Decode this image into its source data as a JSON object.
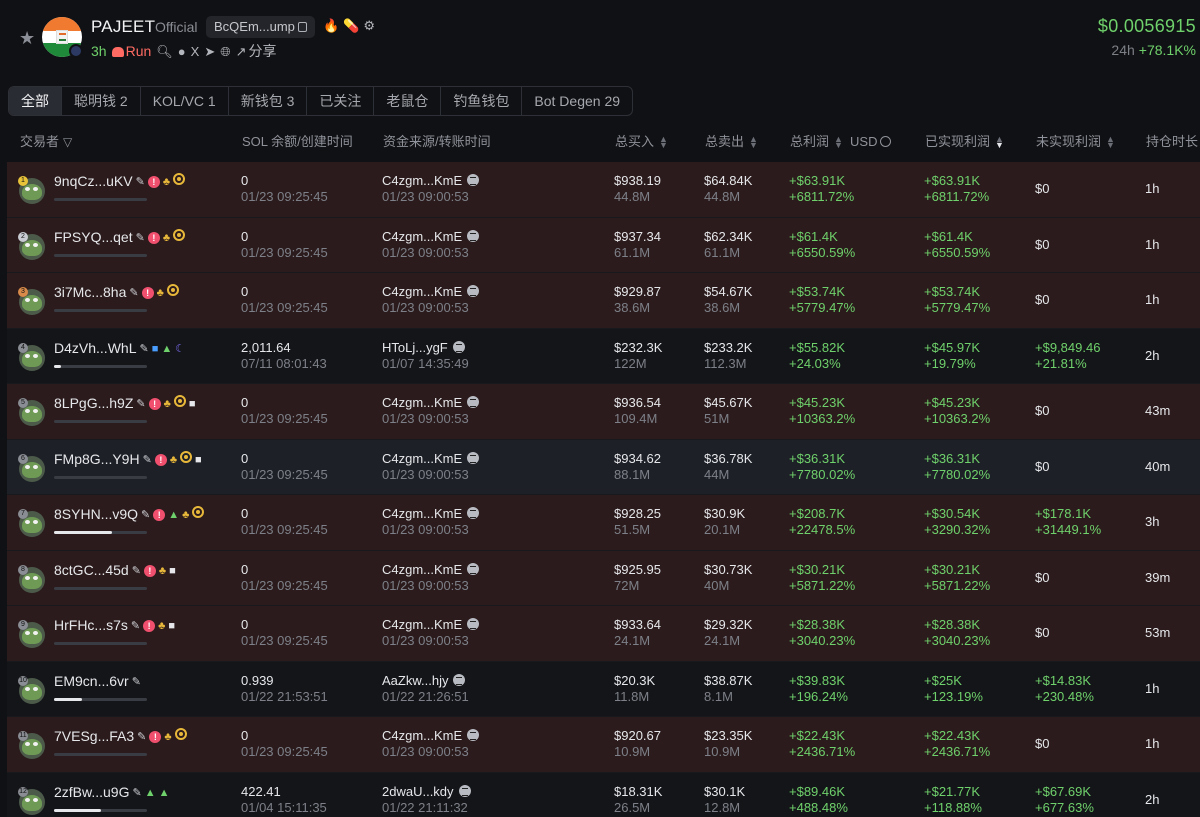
{
  "header": {
    "token_name": "PAJEET",
    "tag": "Official",
    "address": "BcQEm...ump",
    "age": "3h",
    "run": "Run",
    "share": "分享",
    "price": "$0.0056915",
    "change_label": "24h",
    "change_value": "+78.1K%",
    "accent": "#6fd16b"
  },
  "tabs": [
    {
      "label": "全部"
    },
    {
      "label": "聪明钱 2"
    },
    {
      "label": "KOL/VC 1"
    },
    {
      "label": "新钱包 3"
    },
    {
      "label": "已关注"
    },
    {
      "label": "老鼠仓"
    },
    {
      "label": "钓鱼钱包"
    },
    {
      "label": "Bot Degen 29"
    }
  ],
  "columns": {
    "trader": "交易者",
    "sol": "SOL 余额/创建时间",
    "source": "资金来源/转账时间",
    "buy": "总买入",
    "sell": "总卖出",
    "pnl": "总利润",
    "pnl_unit": "USD",
    "realized": "已实现利润",
    "unrealized": "未实现利润",
    "hold": "持仓时长"
  },
  "rows": [
    {
      "rank": "1",
      "addr": "9nqCz...uKV",
      "icons": "pen,warn,grp,tgt",
      "bar": 0,
      "sol": "0",
      "created": "01/23 09:25:45",
      "src": "C4zgm...KmE",
      "src_time": "01/23 09:00:53",
      "buy": "$938.19",
      "buy_sub": "44.8M",
      "sell": "$64.84K",
      "sell_sub": "44.8M",
      "pnl": "+$63.91K",
      "pnl_pct": "+6811.72%",
      "real": "+$63.91K",
      "real_pct": "+6811.72%",
      "unreal": "$0",
      "unreal_pct": "",
      "hold": "1h",
      "style": "red"
    },
    {
      "rank": "2",
      "addr": "FPSYQ...qet",
      "icons": "pen,warn,grp,tgt",
      "bar": 0,
      "sol": "0",
      "created": "01/23 09:25:45",
      "src": "C4zgm...KmE",
      "src_time": "01/23 09:00:53",
      "buy": "$937.34",
      "buy_sub": "61.1M",
      "sell": "$62.34K",
      "sell_sub": "61.1M",
      "pnl": "+$61.4K",
      "pnl_pct": "+6550.59%",
      "real": "+$61.4K",
      "real_pct": "+6550.59%",
      "unreal": "$0",
      "unreal_pct": "",
      "hold": "1h",
      "style": "red"
    },
    {
      "rank": "3",
      "addr": "3i7Mc...8ha",
      "icons": "pen,warn,grp,tgt",
      "bar": 0,
      "sol": "0",
      "created": "01/23 09:25:45",
      "src": "C4zgm...KmE",
      "src_time": "01/23 09:00:53",
      "buy": "$929.87",
      "buy_sub": "38.6M",
      "sell": "$54.67K",
      "sell_sub": "38.6M",
      "pnl": "+$53.74K",
      "pnl_pct": "+5779.47%",
      "real": "+$53.74K",
      "real_pct": "+5779.47%",
      "unreal": "$0",
      "unreal_pct": "",
      "hold": "1h",
      "style": "red"
    },
    {
      "rank": "4",
      "addr": "D4zVh...WhL",
      "icons": "pen,blue,green,moon",
      "bar": 0.08,
      "sol": "2,011.64",
      "created": "07/11 08:01:43",
      "src": "HToLj...ygF",
      "src_time": "01/07 14:35:49",
      "buy": "$232.3K",
      "buy_sub": "122M",
      "sell": "$233.2K",
      "sell_sub": "112.3M",
      "pnl": "+$55.82K",
      "pnl_pct": "+24.03%",
      "real": "+$45.97K",
      "real_pct": "+19.79%",
      "unreal": "+$9,849.46",
      "unreal_pct": "+21.81%",
      "hold": "2h",
      "style": "dark"
    },
    {
      "rank": "5",
      "addr": "8LPgG...h9Z",
      "icons": "pen,warn,grp,tgt,doc",
      "bar": 0,
      "sol": "0",
      "created": "01/23 09:25:45",
      "src": "C4zgm...KmE",
      "src_time": "01/23 09:00:53",
      "buy": "$936.54",
      "buy_sub": "109.4M",
      "sell": "$45.67K",
      "sell_sub": "51M",
      "pnl": "+$45.23K",
      "pnl_pct": "+10363.2%",
      "real": "+$45.23K",
      "real_pct": "+10363.2%",
      "unreal": "$0",
      "unreal_pct": "",
      "hold": "43m",
      "style": "red"
    },
    {
      "rank": "6",
      "addr": "FMp8G...Y9H",
      "icons": "pen,warn,grp,tgt,doc",
      "bar": 0,
      "sol": "0",
      "created": "01/23 09:25:45",
      "src": "C4zgm...KmE",
      "src_time": "01/23 09:00:53",
      "buy": "$934.62",
      "buy_sub": "88.1M",
      "sell": "$36.78K",
      "sell_sub": "44M",
      "pnl": "+$36.31K",
      "pnl_pct": "+7780.02%",
      "real": "+$36.31K",
      "real_pct": "+7780.02%",
      "unreal": "$0",
      "unreal_pct": "",
      "hold": "40m",
      "style": "hi"
    },
    {
      "rank": "7",
      "addr": "8SYHN...v9Q",
      "icons": "pen,warn,green,grp,tgt",
      "bar": 0.62,
      "sol": "0",
      "created": "01/23 09:25:45",
      "src": "C4zgm...KmE",
      "src_time": "01/23 09:00:53",
      "buy": "$928.25",
      "buy_sub": "51.5M",
      "sell": "$30.9K",
      "sell_sub": "20.1M",
      "pnl": "+$208.7K",
      "pnl_pct": "+22478.5%",
      "real": "+$30.54K",
      "real_pct": "+3290.32%",
      "unreal": "+$178.1K",
      "unreal_pct": "+31449.1%",
      "hold": "3h",
      "style": "red"
    },
    {
      "rank": "8",
      "addr": "8ctGC...45d",
      "icons": "pen,warn,grp,doc",
      "bar": 0,
      "sol": "0",
      "created": "01/23 09:25:45",
      "src": "C4zgm...KmE",
      "src_time": "01/23 09:00:53",
      "buy": "$925.95",
      "buy_sub": "72M",
      "sell": "$30.73K",
      "sell_sub": "40M",
      "pnl": "+$30.21K",
      "pnl_pct": "+5871.22%",
      "real": "+$30.21K",
      "real_pct": "+5871.22%",
      "unreal": "$0",
      "unreal_pct": "",
      "hold": "39m",
      "style": "red"
    },
    {
      "rank": "9",
      "addr": "HrFHc...s7s",
      "icons": "pen,warn,grp,doc",
      "bar": 0,
      "sol": "0",
      "created": "01/23 09:25:45",
      "src": "C4zgm...KmE",
      "src_time": "01/23 09:00:53",
      "buy": "$933.64",
      "buy_sub": "24.1M",
      "sell": "$29.32K",
      "sell_sub": "24.1M",
      "pnl": "+$28.38K",
      "pnl_pct": "+3040.23%",
      "real": "+$28.38K",
      "real_pct": "+3040.23%",
      "unreal": "$0",
      "unreal_pct": "",
      "hold": "53m",
      "style": "red"
    },
    {
      "rank": "10",
      "addr": "EM9cn...6vr",
      "icons": "pen",
      "bar": 0.3,
      "sol": "0.939",
      "created": "01/22 21:53:51",
      "src": "AaZkw...hjy",
      "src_time": "01/22 21:26:51",
      "buy": "$20.3K",
      "buy_sub": "11.8M",
      "sell": "$38.87K",
      "sell_sub": "8.1M",
      "pnl": "+$39.83K",
      "pnl_pct": "+196.24%",
      "real": "+$25K",
      "real_pct": "+123.19%",
      "unreal": "+$14.83K",
      "unreal_pct": "+230.48%",
      "hold": "1h",
      "style": "dark"
    },
    {
      "rank": "11",
      "addr": "7VESg...FA3",
      "icons": "pen,warn,grp,tgt",
      "bar": 0,
      "sol": "0",
      "created": "01/23 09:25:45",
      "src": "C4zgm...KmE",
      "src_time": "01/23 09:00:53",
      "buy": "$920.67",
      "buy_sub": "10.9M",
      "sell": "$23.35K",
      "sell_sub": "10.9M",
      "pnl": "+$22.43K",
      "pnl_pct": "+2436.71%",
      "real": "+$22.43K",
      "real_pct": "+2436.71%",
      "unreal": "$0",
      "unreal_pct": "",
      "hold": "1h",
      "style": "red"
    },
    {
      "rank": "12",
      "addr": "2zfBw...u9G",
      "icons": "pen,green,green",
      "bar": 0.5,
      "sol": "422.41",
      "created": "01/04 15:11:35",
      "src": "2dwaU...kdy",
      "src_time": "01/22 21:11:32",
      "buy": "$18.31K",
      "buy_sub": "26.5M",
      "sell": "$30.1K",
      "sell_sub": "12.8M",
      "pnl": "+$89.46K",
      "pnl_pct": "+488.48%",
      "real": "+$21.77K",
      "real_pct": "+118.88%",
      "unreal": "+$67.69K",
      "unreal_pct": "+677.63%",
      "hold": "2h",
      "style": "dark"
    }
  ]
}
